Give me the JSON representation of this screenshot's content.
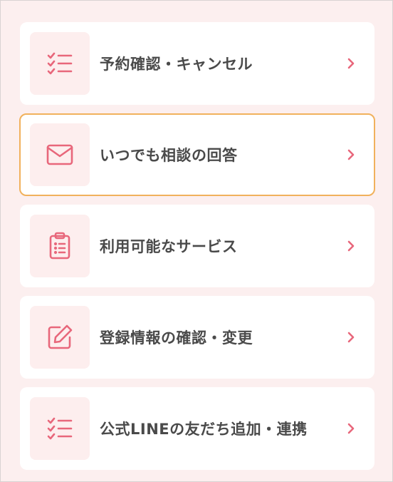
{
  "colors": {
    "background": "#fcefef",
    "card": "#ffffff",
    "icon_bg": "#fdeeee",
    "icon_stroke": "#e8677b",
    "label_text": "#4a4a4a",
    "active_border": "#f1b15c"
  },
  "menu": {
    "items": [
      {
        "label": "予約確認・キャンセル",
        "icon": "checklist-icon",
        "active": false
      },
      {
        "label": "いつでも相談の回答",
        "icon": "envelope-icon",
        "active": true
      },
      {
        "label": "利用可能なサービス",
        "icon": "clipboard-list-icon",
        "active": false
      },
      {
        "label": "登録情報の確認・変更",
        "icon": "edit-icon",
        "active": false
      },
      {
        "label": "公式LINEの友だち追加・連携",
        "icon": "checklist-icon",
        "active": false
      }
    ]
  }
}
